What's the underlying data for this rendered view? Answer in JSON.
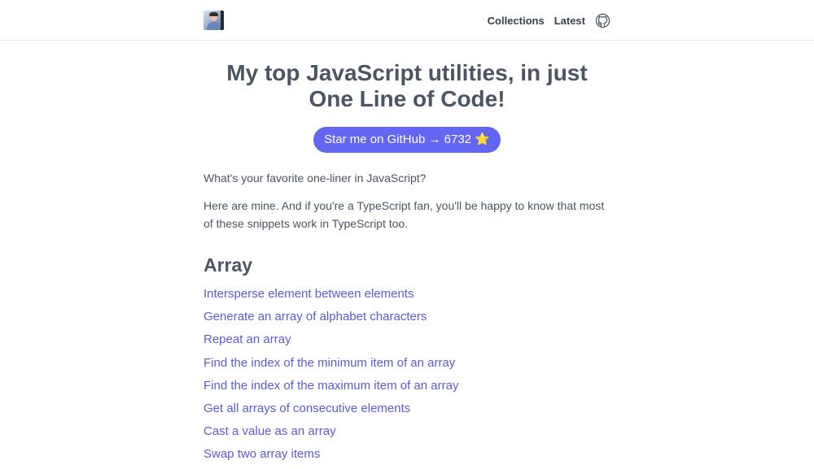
{
  "header": {
    "avatar_icon": "profile-photo",
    "nav": [
      {
        "label": "Collections"
      },
      {
        "label": "Latest"
      }
    ],
    "github_icon": "github-icon"
  },
  "main": {
    "title": "My top JavaScript utilities, in just One Line of Code!",
    "star_button": {
      "label": "Star me on GitHub → 6732",
      "emoji": "⭐"
    },
    "intro": [
      "What's your favorite one-liner in JavaScript?",
      "Here are mine. And if you're a TypeScript fan, you'll be happy to know that most of these snippets work in TypeScript too."
    ],
    "section": {
      "title": "Array",
      "links": [
        "Intersperse element between elements",
        "Generate an array of alphabet characters",
        "Repeat an array",
        "Find the index of the minimum item of an array",
        "Find the index of the maximum item of an array",
        "Get all arrays of consecutive elements",
        "Cast a value as an array",
        "Swap two array items"
      ]
    }
  },
  "colors": {
    "accent": "#6366f1",
    "link": "#5b5bd6",
    "text": "#4b5563",
    "star": "#fbbf24"
  }
}
